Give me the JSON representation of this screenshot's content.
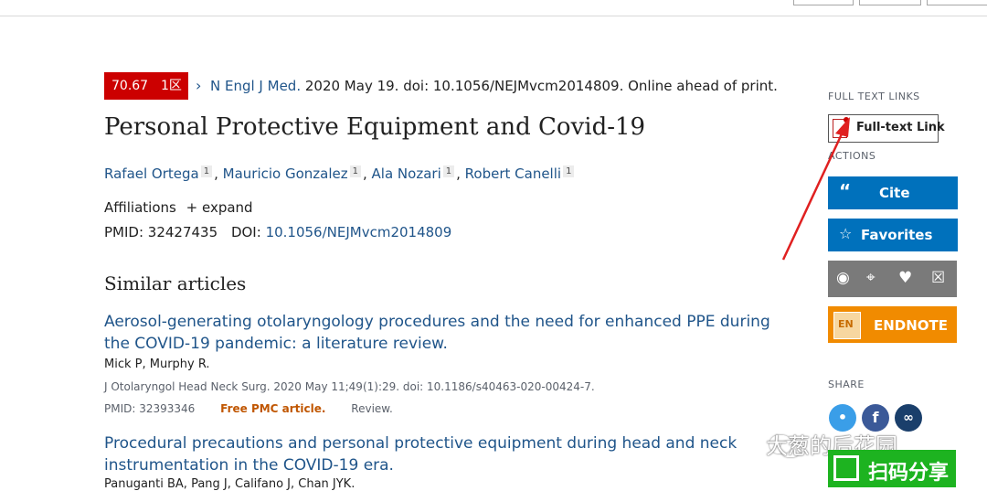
{
  "article": {
    "impact_factor": "70.67",
    "zone": "1区",
    "journal": "N Engl J Med.",
    "citation_rest": " 2020 May 19. doi: 10.1056/NEJMvcm2014809. Online ahead of print.",
    "title": "Personal Protective Equipment and Covid-19",
    "authors": [
      {
        "name": "Rafael Ortega",
        "sup": "1"
      },
      {
        "name": "Mauricio Gonzalez",
        "sup": "1"
      },
      {
        "name": "Ala Nozari",
        "sup": "1"
      },
      {
        "name": "Robert Canelli",
        "sup": "1"
      }
    ],
    "affiliations_label": "Affiliations",
    "expand_label": "expand",
    "pmid_label": "PMID:",
    "pmid": "32427435",
    "doi_label": "DOI:",
    "doi": "10.1056/NEJMvcm2014809"
  },
  "similar": {
    "heading": "Similar articles",
    "items": [
      {
        "title": "Aerosol-generating otolaryngology procedures and the need for enhanced PPE during the COVID-19 pandemic: a literature review.",
        "authors": "Mick P, Murphy R.",
        "journal": "J Otolaryngol Head Neck Surg. 2020 May 11;49(1):29. doi: 10.1186/s40463-020-00424-7.",
        "pmid": "PMID: 32393346",
        "free": "Free PMC article.",
        "type": "Review."
      },
      {
        "title": "Procedural precautions and personal protective equipment during head and neck instrumentation in the COVID-19 era.",
        "authors": "Panuganti BA, Pang J, Califano J, Chan JYK."
      }
    ]
  },
  "sidebar": {
    "full_text_heading": "FULL TEXT LINKS",
    "full_text_button": "Full-text Link",
    "actions_heading": "ACTIONS",
    "cite_label": "Cite",
    "favorites_label": "Favorites",
    "endnote_label": "ENDNOTE",
    "endnote_icon_text": "EN",
    "share_heading": "SHARE"
  },
  "overlay": {
    "watermark": "大葱的后花园",
    "scan_share": "扫码分享"
  },
  "colors": {
    "link": "#20558a",
    "accent_blue": "#0071bc",
    "badge_red": "#cc0000",
    "endnote_orange": "#f18b00",
    "annotation_red": "#e02020"
  },
  "icons": [
    "pdf-icon",
    "quote-icon",
    "star-icon",
    "eye-icon",
    "pin-icon",
    "heart-icon",
    "trash-icon",
    "endnote-icon",
    "twitter-icon",
    "facebook-icon",
    "link-icon",
    "wechat-icon"
  ]
}
